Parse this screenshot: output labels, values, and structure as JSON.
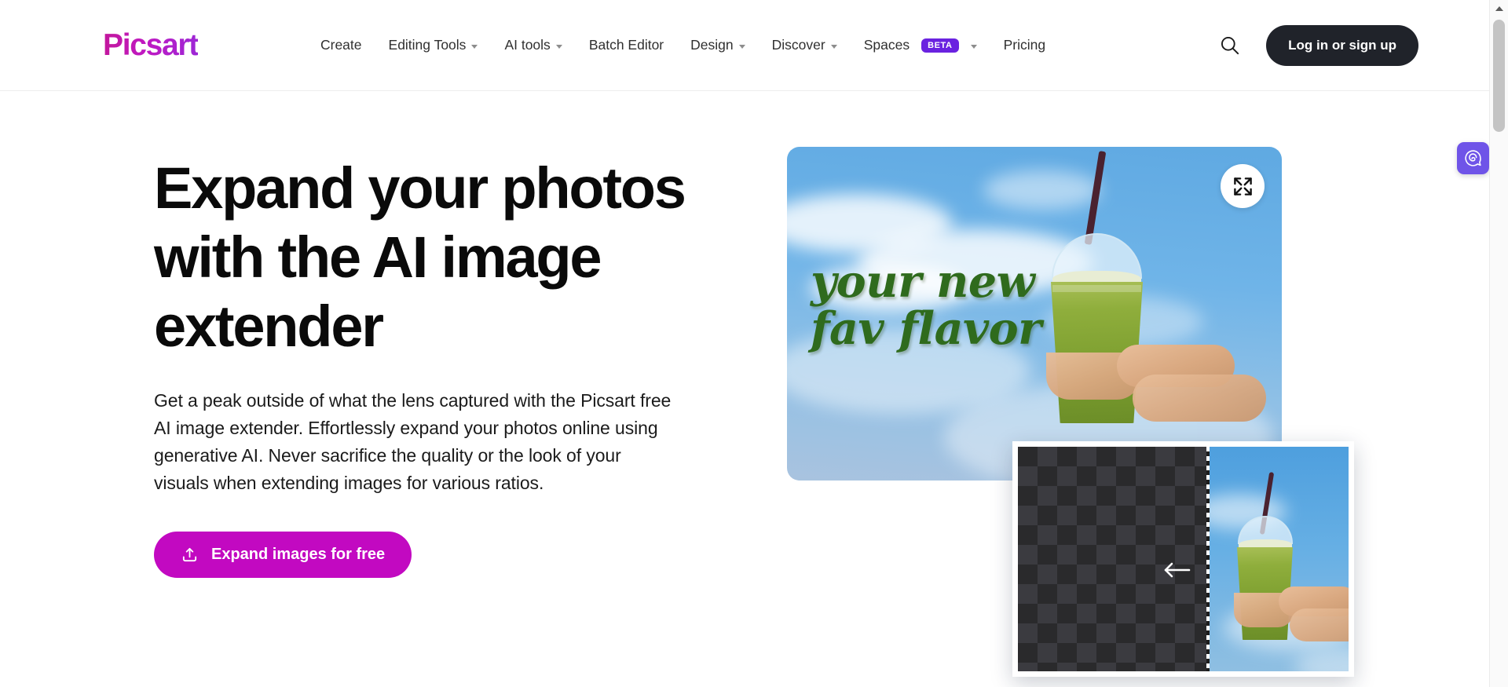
{
  "header": {
    "logo_text": "Picsart",
    "nav_items": [
      {
        "label": "Create",
        "has_caret": false,
        "badge": ""
      },
      {
        "label": "Editing Tools",
        "has_caret": true,
        "badge": ""
      },
      {
        "label": "AI tools",
        "has_caret": true,
        "badge": ""
      },
      {
        "label": "Batch Editor",
        "has_caret": false,
        "badge": ""
      },
      {
        "label": "Design",
        "has_caret": true,
        "badge": ""
      },
      {
        "label": "Discover",
        "has_caret": true,
        "badge": ""
      },
      {
        "label": "Spaces",
        "has_caret": true,
        "badge": "BETA"
      },
      {
        "label": "Pricing",
        "has_caret": false,
        "badge": ""
      }
    ],
    "search_icon": "search-icon",
    "login_label": "Log in or sign up"
  },
  "hero": {
    "headline": "Expand your photos with the AI image extender",
    "subtext": "Get a peak outside of what the lens captured with the Picsart free AI image extender. Effortlessly expand your photos online using generative AI. Never sacrifice the quality or the look of your visuals when extending images for various ratios.",
    "cta_label": "Expand images for free",
    "cta_icon": "upload-icon"
  },
  "hero_image": {
    "caption_line1": "your new",
    "caption_line2": "fav flavor",
    "expand_icon": "expand-arrows-icon",
    "alt": "matcha drink held in hand against blue sky"
  },
  "overlay_card": {
    "arrow_icon": "arrow-left-icon",
    "alt": "transparency checkerboard next to photo of matcha drink"
  },
  "chat_widget": {
    "icon": "chat-spiral-icon"
  },
  "scrollbar": {
    "up_arrow_icon": "scroll-up-arrow-icon"
  },
  "colors": {
    "brand_magenta": "#C209C1",
    "beta_purple": "#6A22E0",
    "login_dark": "#20232A",
    "caption_green": "#2F6B1D",
    "chat_purple": "#6F54E8"
  }
}
